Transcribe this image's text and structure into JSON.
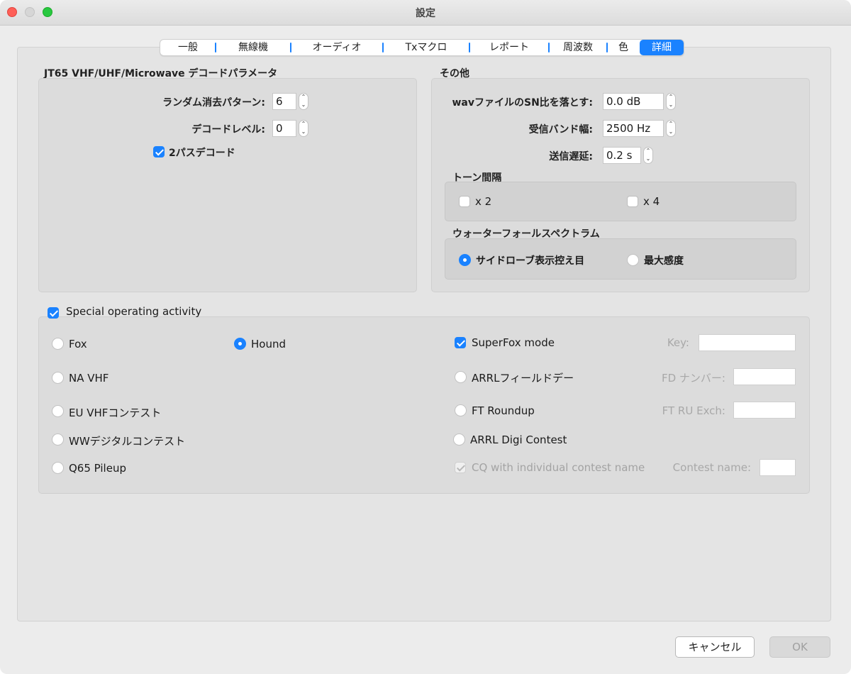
{
  "window": {
    "title": "設定"
  },
  "tabs": [
    {
      "label": "一般"
    },
    {
      "label": "無線機"
    },
    {
      "label": "オーディオ"
    },
    {
      "label": "Txマクロ"
    },
    {
      "label": "レポート"
    },
    {
      "label": "周波数"
    },
    {
      "label": "色"
    },
    {
      "label": "詳細",
      "active": true
    }
  ],
  "jt65": {
    "title": "JT65 VHF/UHF/Microwave デコードパラメータ",
    "random_erasure_label": "ランダム消去パターン:",
    "random_erasure_value": "6",
    "decode_level_label": "デコードレベル:",
    "decode_level_value": "0",
    "two_pass_label": "2パスデコード",
    "two_pass_checked": true
  },
  "misc": {
    "title": "その他",
    "wav_sn_label": "wavファイルのSN比を落とす:",
    "wav_sn_value": "0.0 dB",
    "rx_bandwidth_label": "受信バンド幅:",
    "rx_bandwidth_value": "2500  Hz",
    "tx_delay_label": "送信遅延:",
    "tx_delay_value": "0.2  s",
    "tone_spacing": {
      "title": "トーン間隔",
      "x2_label": "x 2",
      "x4_label": "x 4"
    },
    "waterfall": {
      "title": "ウォーターフォールスペクトラム",
      "low_sidelobes_label": "サイドローブ表示控え目",
      "max_sensitivity_label": "最大感度",
      "selected": "low_sidelobes"
    }
  },
  "special": {
    "title": "Special operating activity",
    "checked": true,
    "options": {
      "fox": "Fox",
      "hound": "Hound",
      "na_vhf": "NA VHF",
      "eu_vhf": "EU VHFコンテスト",
      "ww_digi": "WWデジタルコンテスト",
      "q65": "Q65 Pileup",
      "arrl_field_day": "ARRLフィールドデー",
      "ft_roundup": "FT Roundup",
      "arrl_digi": "ARRL Digi Contest"
    },
    "selected": "hound",
    "superfox_label": "SuperFox mode",
    "superfox_checked": true,
    "cq_contest_label": "CQ with individual contest name",
    "key_label": "Key:",
    "fd_number_label": "FD ナンバー:",
    "ft_ru_exch_label": "FT RU Exch:",
    "contest_name_label": "Contest name:"
  },
  "buttons": {
    "cancel": "キャンセル",
    "ok": "OK"
  },
  "colors": {
    "accent": "#1a82ff",
    "panel": "#e4e4e4"
  }
}
